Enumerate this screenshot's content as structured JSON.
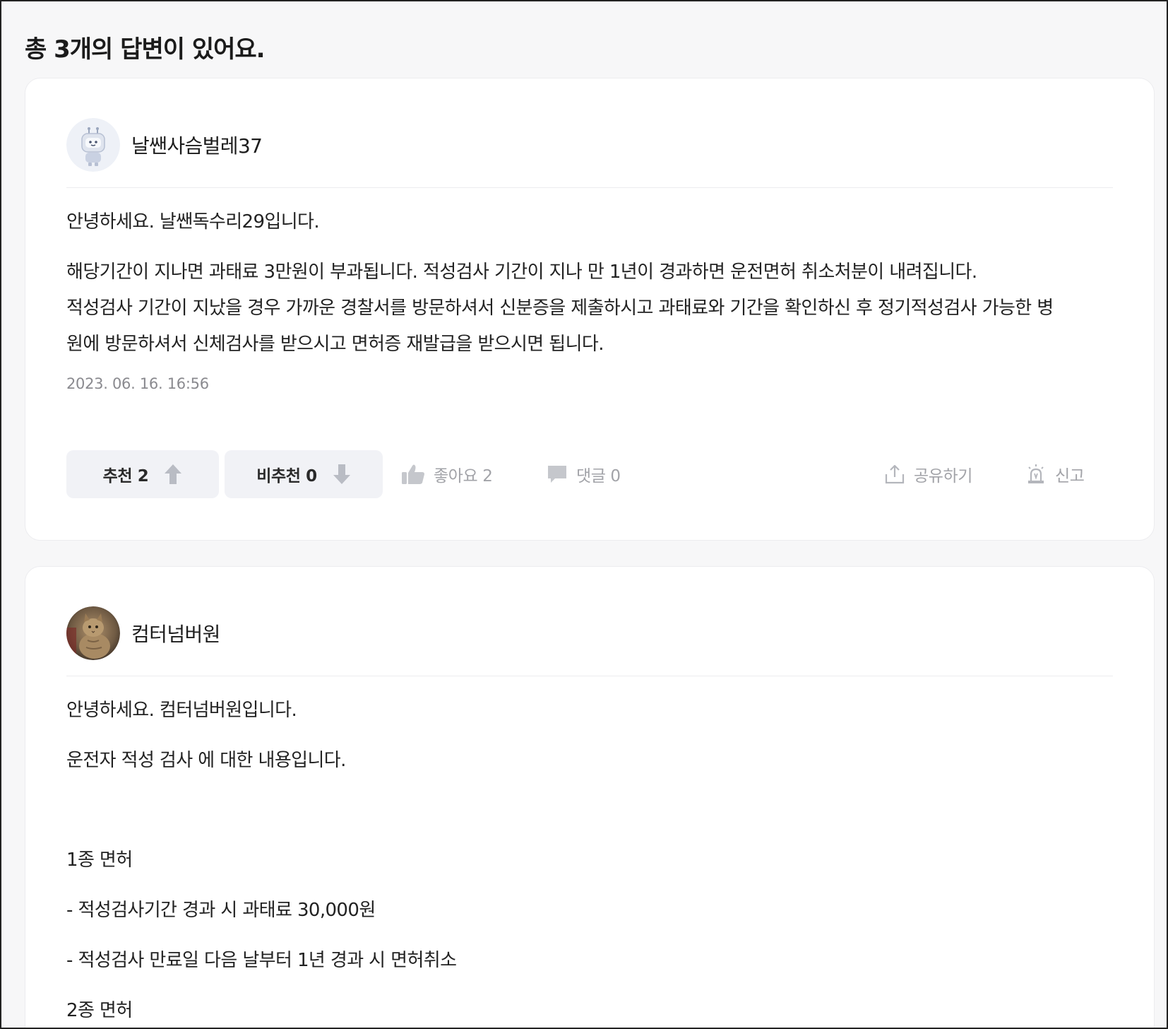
{
  "heading": "총 3개의 답변이 있어요.",
  "answers": [
    {
      "author": "날쌘사슴벌레37",
      "avatar_icon": "robot-avatar-icon",
      "paragraphs": [
        "안녕하세요. 날쌘독수리29입니다.",
        "해당기간이 지나면 과태료 3만원이 부과됩니다. 적성검사 기간이 지나 만 1년이 경과하면 운전면허 취소처분이 내려집니다.",
        "적성검사 기간이 지났을 경우 가까운 경찰서를 방문하셔서 신분증을 제출하시고 과태료와 기간을 확인하신 후 정기적성검사 가능한 병",
        "원에 방문하셔서 신체검사를 받으시고 면허증 재발급을 받으시면 됩니다."
      ],
      "timestamp": "2023. 06. 16. 16:56",
      "upvote_label": "추천 2",
      "downvote_label": "비추천 0",
      "like_label": "좋아요 2",
      "comment_label": "댓글 0",
      "share_label": "공유하기",
      "report_label": "신고"
    },
    {
      "author": "컴터넘버원",
      "avatar_icon": "cat-photo-avatar",
      "paragraphs": [
        "안녕하세요. 컴터넘버원입니다.",
        "운전자 적성 검사 에 대한 내용입니다.",
        "1종 면허",
        "- 적성검사기간 경과 시 과태료 30,000원",
        "- 적성검사 만료일 다음 날부터 1년 경과 시 면허취소",
        "2종 면허"
      ]
    }
  ],
  "colors": {
    "page_bg": "#f7f7f8",
    "card_bg": "#ffffff",
    "muted_text": "#8a8a8f",
    "icon_gray": "#a2a3a8",
    "vote_bg": "#f1f2f6",
    "vote_arrow": "#b9bcc4"
  }
}
